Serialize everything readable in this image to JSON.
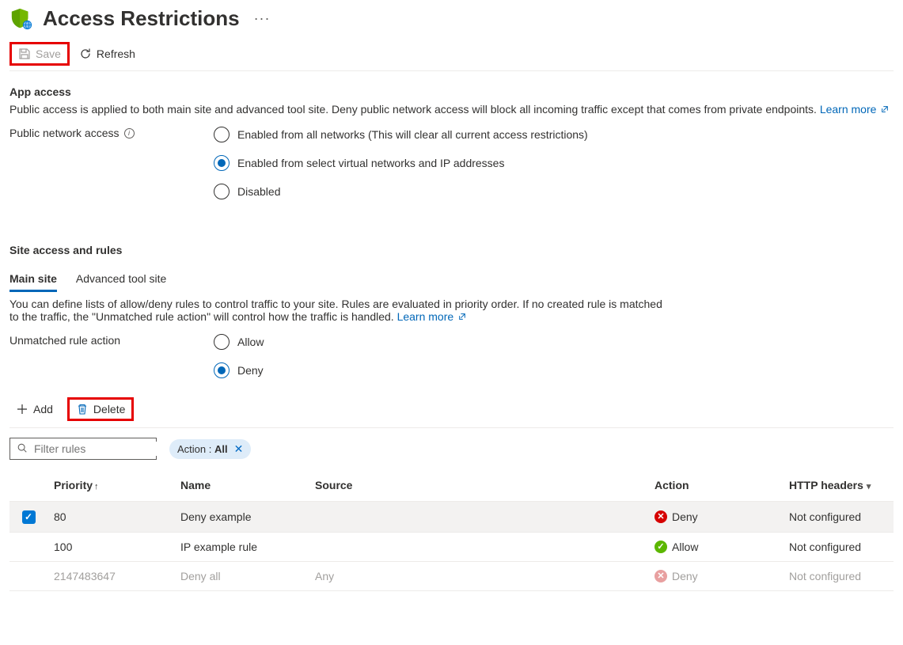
{
  "header": {
    "title": "Access Restrictions"
  },
  "toolbar": {
    "save_label": "Save",
    "refresh_label": "Refresh"
  },
  "app_access": {
    "title": "App access",
    "description": "Public access is applied to both main site and advanced tool site. Deny public network access will block all incoming traffic except that comes from private endpoints.",
    "learn_more": "Learn more",
    "field_label": "Public network access",
    "options": {
      "all": "Enabled from all networks (This will clear all current access restrictions)",
      "select": "Enabled from select virtual networks and IP addresses",
      "disabled": "Disabled"
    }
  },
  "site_access": {
    "title": "Site access and rules",
    "tabs": {
      "main": "Main site",
      "advanced": "Advanced tool site"
    },
    "description": "You can define lists of allow/deny rules to control traffic to your site. Rules are evaluated in priority order. If no created rule is matched to the traffic, the \"Unmatched rule action\" will control how the traffic is handled.",
    "learn_more": "Learn more",
    "unmatched_label": "Unmatched rule action",
    "unmatched_options": {
      "allow": "Allow",
      "deny": "Deny"
    }
  },
  "rules_toolbar": {
    "add": "Add",
    "delete": "Delete"
  },
  "filter": {
    "placeholder": "Filter rules",
    "pill_label": "Action :",
    "pill_value": "All"
  },
  "table": {
    "headers": {
      "priority": "Priority",
      "name": "Name",
      "source": "Source",
      "action": "Action",
      "http": "HTTP headers"
    },
    "rows": [
      {
        "checked": true,
        "priority": "80",
        "name": "Deny example",
        "source": "",
        "action": "Deny",
        "http": "Not configured",
        "action_type": "deny"
      },
      {
        "checked": false,
        "priority": "100",
        "name": "IP example rule",
        "source": "",
        "action": "Allow",
        "http": "Not configured",
        "action_type": "allow"
      },
      {
        "checked": false,
        "priority": "2147483647",
        "name": "Deny all",
        "source": "Any",
        "action": "Deny",
        "http": "Not configured",
        "action_type": "deny",
        "muted": true
      }
    ]
  }
}
